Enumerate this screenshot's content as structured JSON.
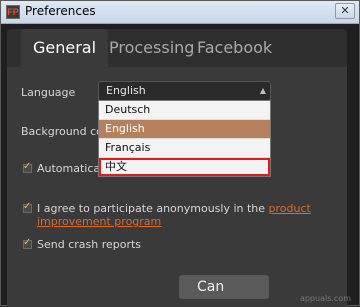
{
  "window": {
    "title": "Preferences",
    "icon_text": "FP",
    "close_symbol": "✕"
  },
  "tabs": [
    {
      "label": "General",
      "active": true
    },
    {
      "label": "Processing",
      "active": false
    },
    {
      "label": "Facebook",
      "active": false
    }
  ],
  "general": {
    "language_label": "Language",
    "language_value": "English",
    "language_options": [
      {
        "label": "Deutsch",
        "state": "normal"
      },
      {
        "label": "English",
        "state": "selected"
      },
      {
        "label": "Français",
        "state": "normal"
      },
      {
        "label": "中文",
        "state": "highlighted"
      }
    ],
    "background_color_label": "Background color",
    "auto_update_label": "Automatically",
    "participate_prefix": "I agree to participate anonymously in the ",
    "participate_link": "product improvement program",
    "crash_reports_label": "Send crash reports"
  },
  "buttons": {
    "cancel_label": "Can"
  },
  "watermark": "appuals.com",
  "colors": {
    "accent": "#e06a2a",
    "selected_option": "#b5805c",
    "highlight_border": "#e01c1c",
    "checkmark": "#ffb14a"
  }
}
